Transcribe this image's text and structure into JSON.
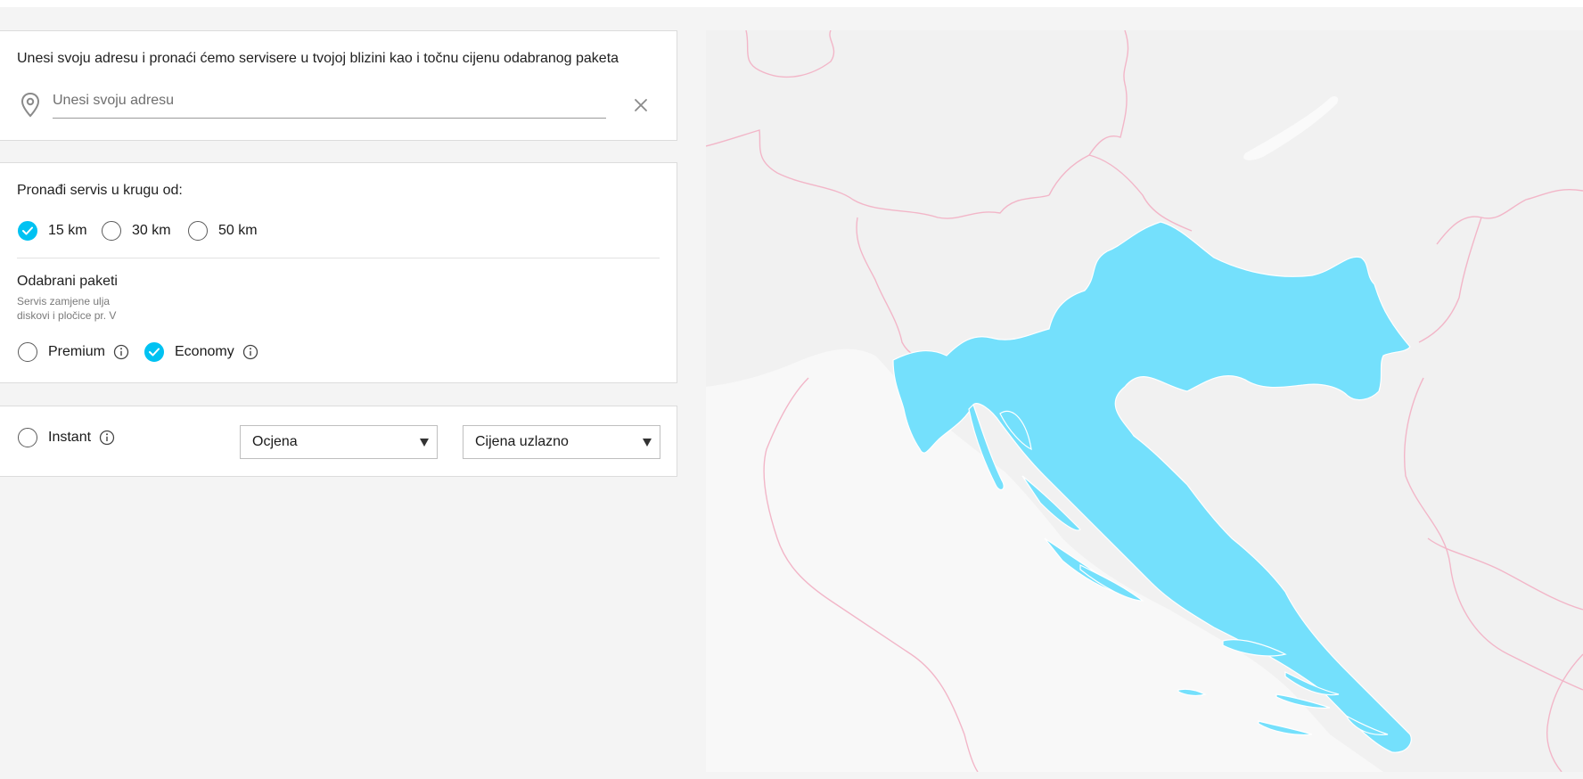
{
  "address": {
    "intro": "Unesi svoju adresu i pronaći ćemo servisere u tvojoj blizini kao i točnu cijenu odabranog paketa",
    "placeholder": "Unesi svoju adresu",
    "value": "",
    "icons": {
      "pin": "location-pin-icon",
      "clear": "close-icon"
    }
  },
  "radius": {
    "title": "Pronađi servis u krugu od:",
    "options": [
      {
        "label": "15 km",
        "selected": true
      },
      {
        "label": "30 km",
        "selected": false
      },
      {
        "label": "50 km",
        "selected": false
      }
    ]
  },
  "packages": {
    "title": "Odabrani paketi",
    "subtitle_line1": "Servis zamjene ulja",
    "subtitle_line2": "diskovi i pločice pr. V",
    "options": [
      {
        "label": "Premium",
        "selected": false
      },
      {
        "label": "Economy",
        "selected": true
      }
    ]
  },
  "filters": {
    "instant": {
      "label": "Instant",
      "selected": false
    },
    "sort_rating": {
      "selected": "Ocjena"
    },
    "sort_price": {
      "selected": "Cijena uzlazno"
    }
  },
  "map": {
    "region": "Croatia",
    "highlight_color": "#74e0fc",
    "border_color": "#f3b5c8"
  },
  "colors": {
    "accent": "#00c2f2",
    "page_background": "#f4f4f4",
    "card_background": "#ffffff"
  }
}
